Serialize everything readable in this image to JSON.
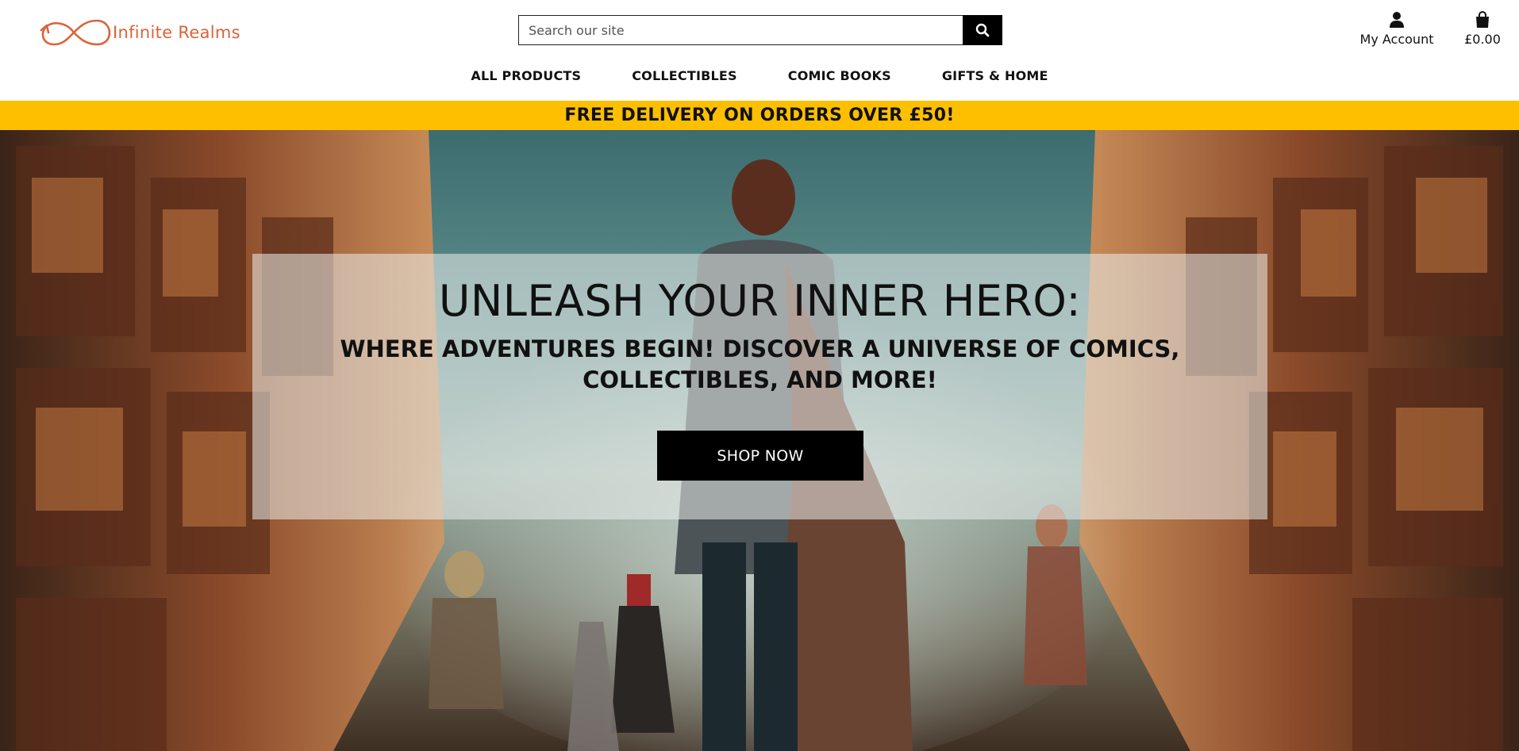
{
  "brand": {
    "name": "Infinite Realms",
    "color": "#d9643a",
    "logo_icon": "infinity-arrow-icon"
  },
  "search": {
    "placeholder": "Search our site",
    "value": "",
    "icon": "search-icon"
  },
  "account": {
    "label": "My Account",
    "icon": "user-icon"
  },
  "basket": {
    "total": "£0.00",
    "icon": "shopping-bag-icon"
  },
  "nav": {
    "items": [
      {
        "label": "ALL PRODUCTS"
      },
      {
        "label": "COLLECTIBLES"
      },
      {
        "label": "COMIC BOOKS"
      },
      {
        "label": "GIFTS & HOME"
      }
    ]
  },
  "promo": {
    "text": "FREE DELIVERY ON ORDERS OVER £50!",
    "color": "#fdbf00"
  },
  "hero": {
    "title": "UNLEASH YOUR INNER HERO:",
    "subtitle": "WHERE ADVENTURES BEGIN! DISCOVER A UNIVERSE OF COMICS, COLLECTIBLES, AND MORE!",
    "cta_label": "SHOP NOW"
  }
}
